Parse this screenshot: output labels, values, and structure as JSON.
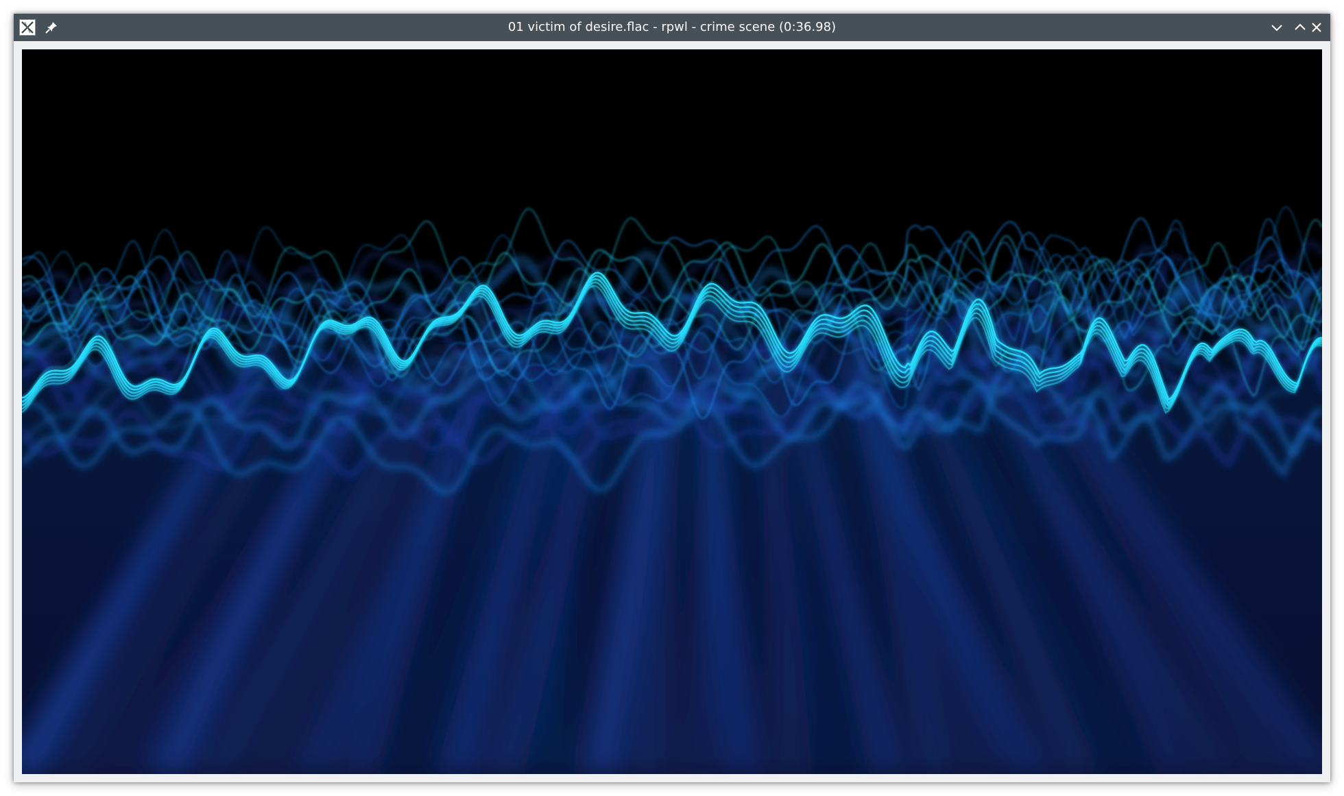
{
  "window": {
    "title": "01 victim of desire.flac - rpwl - crime scene (0:36.98)",
    "icons": {
      "app": "x-window-icon",
      "pin": "pin-icon",
      "minimize": "chevron-down-icon",
      "maximize": "chevron-up-icon",
      "close": "close-icon"
    }
  },
  "visualization": {
    "description_icon": "waveform-visualizer",
    "colors": {
      "background": "#000000",
      "bright": "#29e0ff",
      "mid": "#1c8cf0",
      "deep": "#1a3aa8",
      "dark": "#0a1440"
    }
  }
}
